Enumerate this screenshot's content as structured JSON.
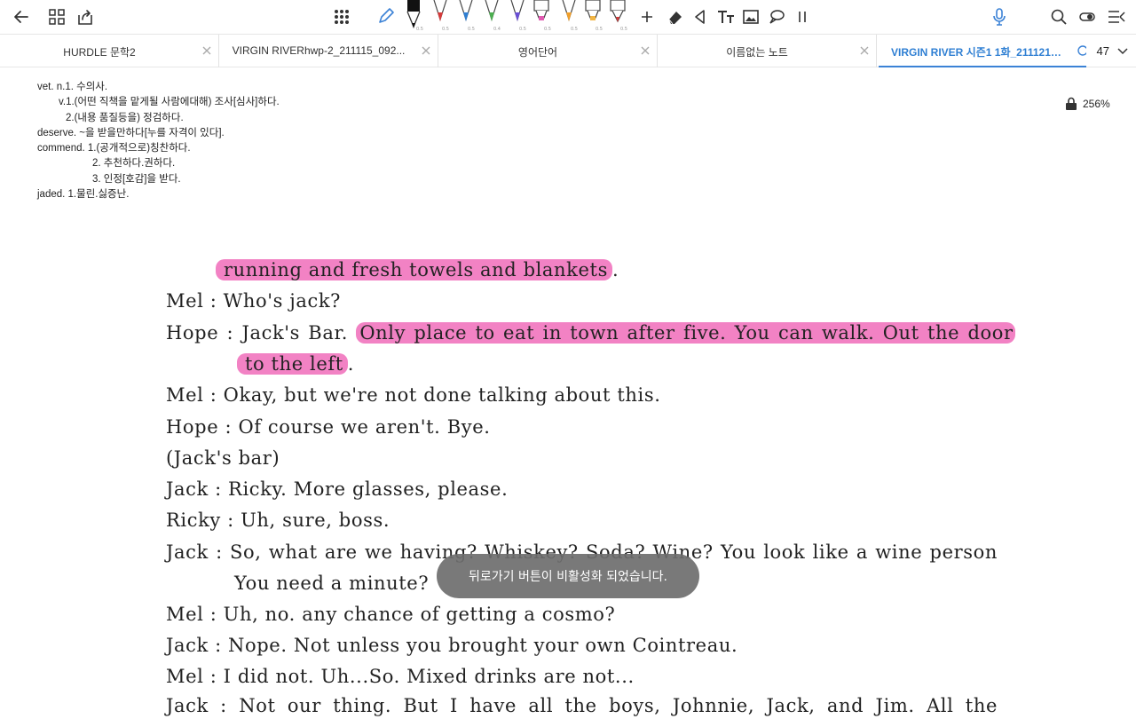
{
  "toolbar": {
    "pen_sizes": [
      "0.5",
      "0.5",
      "0.5",
      "0.4",
      "0.5",
      "0.5",
      "0.5",
      "0.5",
      "0.5"
    ],
    "pen_colors": [
      "#111111",
      "#d63b3b",
      "#2f7fd3",
      "#4caf50",
      "#6a4fd6",
      "#e05ab0",
      "#f2a02a",
      "#f2b544",
      "#d63b3b"
    ],
    "accent": "#3b82d6"
  },
  "tabs": [
    {
      "label": "HURDLE  문학2"
    },
    {
      "label": "VIRGIN RIVERhwp-2_211115_092..."
    },
    {
      "label": "영어단어"
    },
    {
      "label": "이름없는 노트"
    },
    {
      "label": "VIRGIN RIVER 시즌1 1화_211121_..."
    }
  ],
  "page_count": "47",
  "zoom": "256%",
  "notes": [
    "vet. n.1. 수의사.",
    "v.1.(어떤 직책을 맡게될 사람에대해) 조사[심사]하다.",
    "2.(내용 품질등을) 정검하다.",
    "deserve. ~을 받을만하다[누를 자격이 있다].",
    "commend. 1.(공개적으로)칭찬하다.",
    "2. 추천하다.권하다.",
    "3. 인정[호감]을 받다.",
    "jaded. 1.물린.싫증난."
  ],
  "script": {
    "l1_hl": "running and fresh towels and blankets",
    "l1_end": ".",
    "l2": "Mel : Who's jack?",
    "l3_pre": "Hope : Jack's Bar.",
    "l3_hl": "Only place to eat in town after five. You can walk. Out the door",
    "l4_hl": "to the left",
    "l4_end": ".",
    "l5": "Mel : Okay, but we're not done talking about this.",
    "l6": "Hope : Of course we aren't. Bye.",
    "l7": "(Jack's bar)",
    "l8": "Jack : Ricky. More glasses, please.",
    "l9": "Ricky : Uh, sure, boss.",
    "l10": "Jack : So, what are we having? Whiskey? Soda? Wine? You look like a wine person",
    "l11": "You need a minute?",
    "l12": "Mel : Uh, no. any chance of getting a cosmo?",
    "l13": "Jack : Nope. Not unless you brought your own Cointreau.",
    "l14": "Mel : I did not. Uh...So. Mixed drinks are not...",
    "l15": "Jack : Not our thing. But I have all the boys, Johnnie, Jack, and Jim. All the"
  },
  "toast": "뒤로가기 버튼이 비활성화 되었습니다."
}
